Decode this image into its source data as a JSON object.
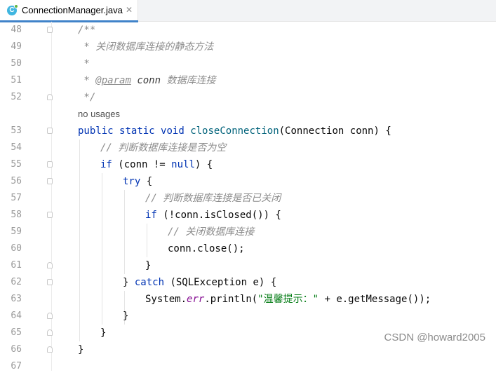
{
  "tab": {
    "title": "ConnectionManager.java",
    "icon_letter": "C",
    "close_glyph": "✕"
  },
  "gutter": {
    "line_numbers": [
      "48",
      "49",
      "50",
      "51",
      "52",
      "53",
      "54",
      "55",
      "56",
      "57",
      "58",
      "59",
      "60",
      "61",
      "62",
      "63",
      "64",
      "65",
      "66",
      "67"
    ]
  },
  "code": {
    "l48": {
      "text": "/**"
    },
    "l49": {
      "text": " * 关闭数据库连接的静态方法"
    },
    "l50": {
      "text": " *"
    },
    "l51": {
      "star": " * ",
      "tag": "@param",
      "param": "conn",
      "desc": " 数据库连接"
    },
    "l52": {
      "text": " */"
    },
    "usages": "no usages",
    "l53": {
      "k1": "public",
      "k2": "static",
      "k3": "void",
      "name": "closeConnection",
      "rest": "(Connection conn) {"
    },
    "l54": {
      "text": "// 判断数据库连接是否为空"
    },
    "l55": {
      "k": "if",
      "mid": " (conn != ",
      "k2": "null",
      "end": ") {"
    },
    "l56": {
      "k": "try",
      "end": " {"
    },
    "l57": {
      "text": "// 判断数据库连接是否已关闭"
    },
    "l58": {
      "k": "if",
      "end": " (!conn.isClosed()) {"
    },
    "l59": {
      "text": "// 关闭数据库连接"
    },
    "l60": {
      "text": "conn.close();"
    },
    "l61": {
      "text": "}"
    },
    "l62": {
      "pre": "} ",
      "k": "catch",
      "end": " (SQLException e) {"
    },
    "l63": {
      "pre": "System.",
      "field": "err",
      "mid": ".println(",
      "str": "\"温馨提示：\"",
      "end": " + e.getMessage());"
    },
    "l64": {
      "text": "}"
    },
    "l65": {
      "text": "}"
    },
    "l66": {
      "text": "}"
    }
  },
  "watermark": "CSDN @howard2005",
  "colors": {
    "keyword": "#0033b3",
    "method": "#00627a",
    "comment": "#8c8c8c",
    "string": "#067d17",
    "static_field": "#871094",
    "tab_accent": "#4083c9"
  }
}
